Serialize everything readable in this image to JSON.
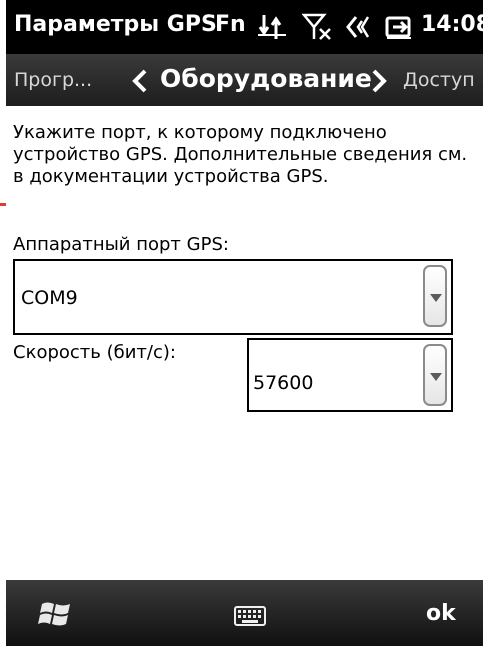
{
  "status_bar": {
    "title": "Параметры GPS",
    "fn_label": "Fn",
    "time": "14:08",
    "icons": [
      "connectivity-icon",
      "no-signal-icon",
      "volume-icon",
      "battery-charging-icon"
    ]
  },
  "tab_strip": {
    "prev_tab": "Прогр...",
    "current_tab": "Оборудование",
    "next_tab": "Доступ"
  },
  "main": {
    "description": "Укажите порт, к которому подключено устройство GPS. Дополнительные сведения см. в документации устройства GPS.",
    "port_label": "Аппаратный порт GPS:",
    "port_value": "COM9",
    "speed_label": "Скорость (бит/с):",
    "speed_value": "57600"
  },
  "bottom_bar": {
    "ok_label": "ok",
    "icons": [
      "windows-start-icon",
      "keyboard-icon"
    ]
  },
  "colors": {
    "status_bg": "#000000",
    "bar_bg": "#2b2b2b",
    "side_marker": "#e23b2e"
  }
}
